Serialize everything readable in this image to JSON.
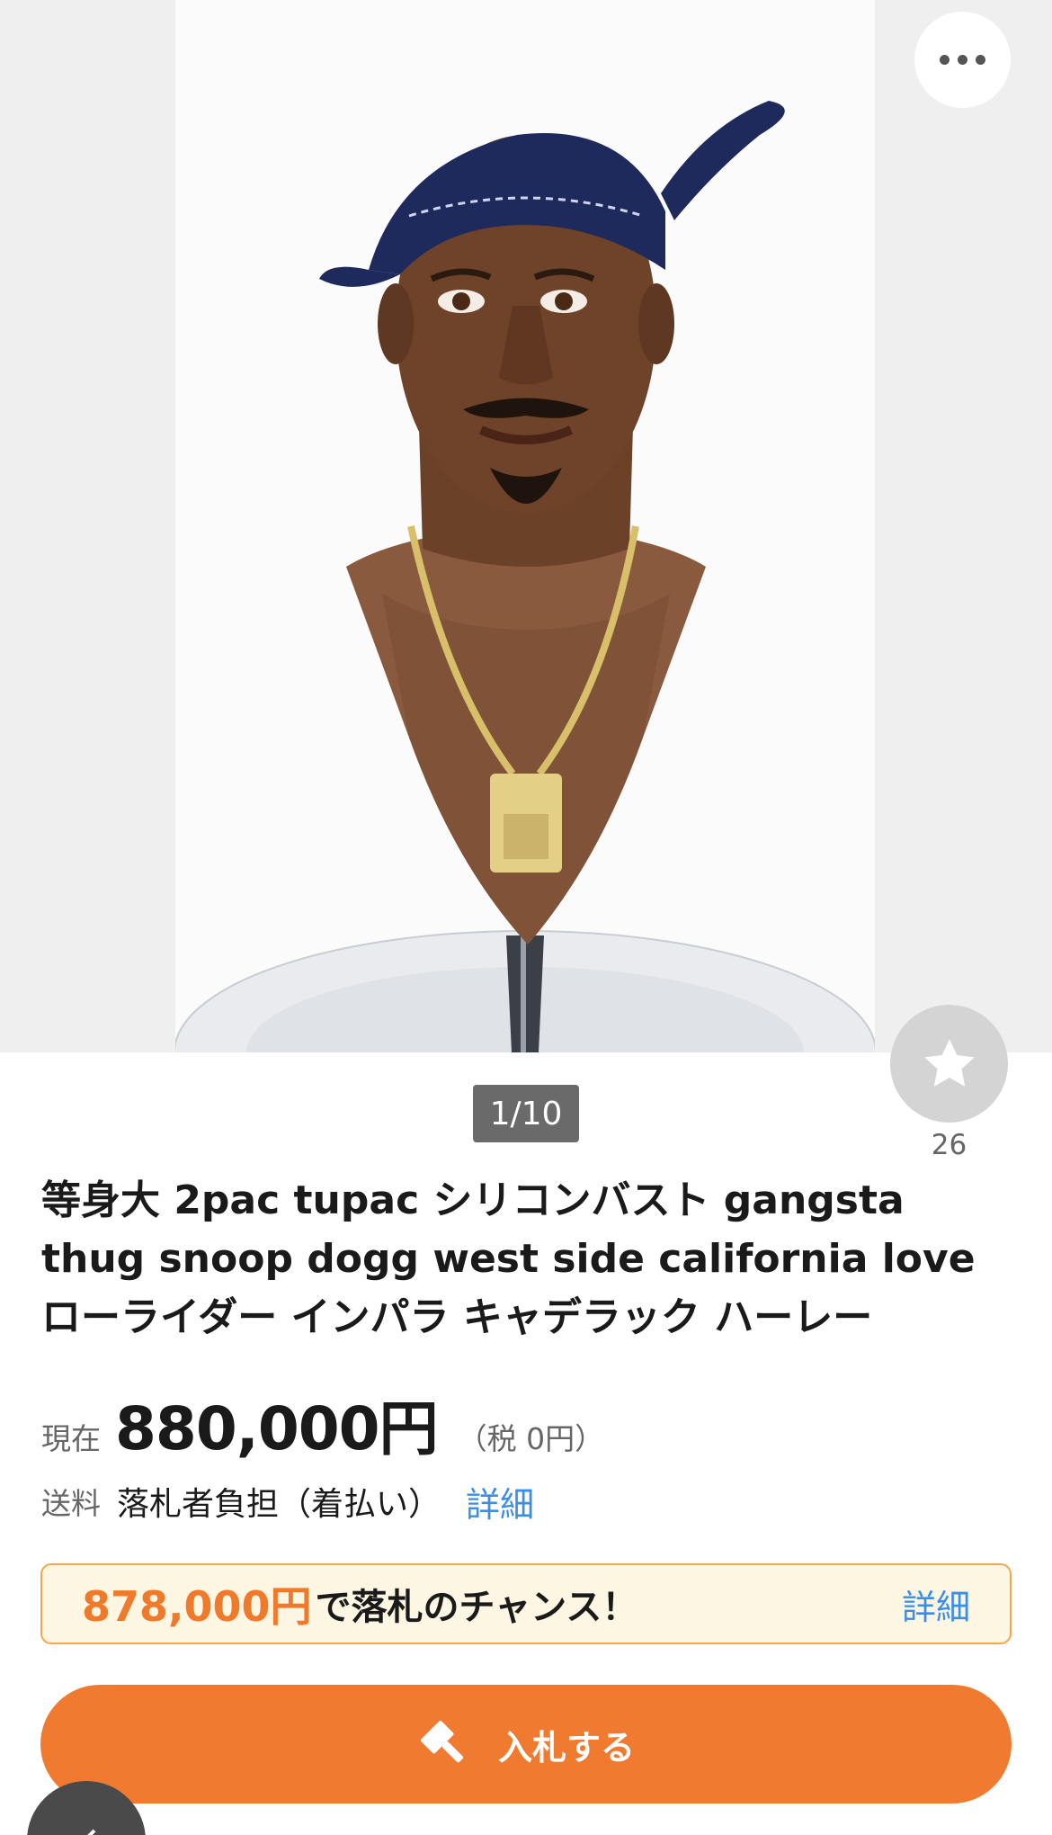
{
  "gallery": {
    "counter": "1/10",
    "favorite_count": "26",
    "more_icon": "ellipsis-icon",
    "favorite_icon": "star-icon"
  },
  "item": {
    "title_line1": "等身大 2pac tupac シリコンバスト gangsta",
    "title_line2": "thug snoop dogg west side california love",
    "title_line3": "ローライダー インパラ キャデラック ハーレー"
  },
  "price": {
    "label": "現在",
    "value": "880,000円",
    "tax": "（税 0円）"
  },
  "shipping": {
    "label": "送料",
    "value": "落札者負担（着払い）",
    "detail_link": "詳細"
  },
  "buy_now_banner": {
    "price": "878,000円",
    "text": "で落札のチャンス！",
    "detail_link": "詳細"
  },
  "bid_button": {
    "label": "入札する",
    "icon": "gavel-icon"
  },
  "colors": {
    "accent": "#ef7a30",
    "link": "#3a8ee6",
    "banner_bg": "#fdf6e3"
  }
}
